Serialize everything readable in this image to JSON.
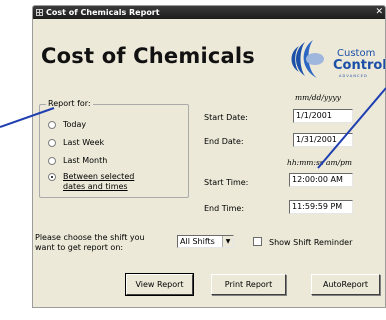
{
  "window": {
    "title": "Cost of Chemicals Report",
    "close_glyph": "✕"
  },
  "heading": "Cost of Chemicals",
  "logo": {
    "line1": "Custom",
    "line2": "Control",
    "subtitle": "A D V A N C E D"
  },
  "report_for": {
    "legend": "Report for:",
    "options": [
      {
        "label": "Today",
        "checked": false
      },
      {
        "label": "Last Week",
        "checked": false
      },
      {
        "label": "Last Month",
        "checked": false
      },
      {
        "label": "Between selected dates and times",
        "label_line1": "Between selected",
        "label_line2": "dates and times",
        "checked": true
      }
    ]
  },
  "dates": {
    "format_hint": "mm/dd/yyyy",
    "start_label": "Start Date:",
    "start_value": "1/1/2001",
    "end_label": "End Date:",
    "end_value": "1/31/2001"
  },
  "times": {
    "format_hint": "hh:mm:ss am/pm",
    "start_label": "Start Time:",
    "start_value": "12:00:00 AM",
    "end_label": "End Time:",
    "end_value": "11:59:59 PM"
  },
  "shift": {
    "prompt_line1": "Please choose the shift you",
    "prompt_line2": "want to get report on:",
    "selected": "All Shifts",
    "dropdown_arrow": "▼"
  },
  "show_shift_reminder": {
    "label": "Show Shift Reminder",
    "checked": false
  },
  "buttons": {
    "view_report": "View Report",
    "print_report": "Print Report",
    "auto_report": "AutoReport"
  },
  "colors": {
    "callout_line": "#1f3fb0",
    "logo_blue": "#1b4fa8",
    "dialog_bg": "#ece9d8"
  }
}
